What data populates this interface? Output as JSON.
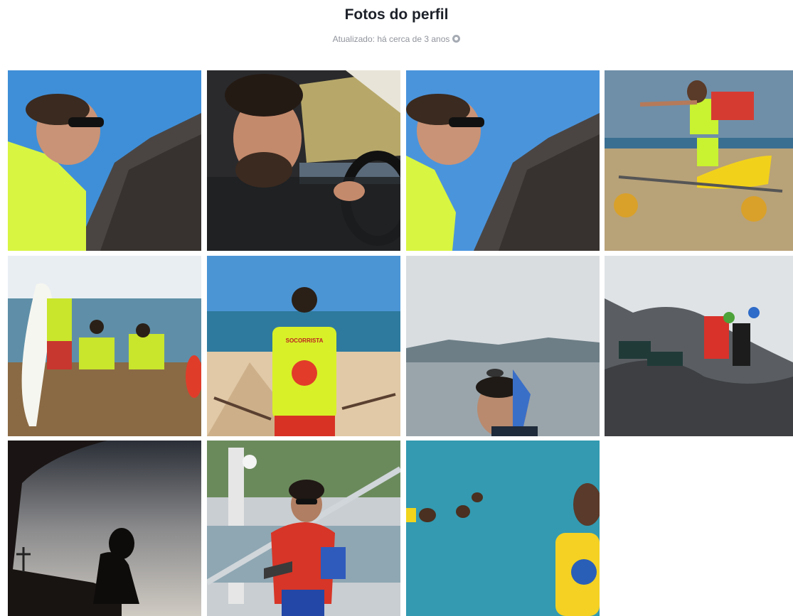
{
  "page": {
    "title": "Fotos do perfil",
    "updated_text": "Atualizado: há cerca de 3 anos",
    "privacy_icon": "globe-icon"
  },
  "photos": [
    {
      "id": "photo-1",
      "desc_icon": "profile-photo"
    },
    {
      "id": "photo-2",
      "desc_icon": "profile-photo"
    },
    {
      "id": "photo-3",
      "desc_icon": "profile-photo"
    },
    {
      "id": "photo-4",
      "desc_icon": "profile-photo"
    },
    {
      "id": "photo-5",
      "desc_icon": "profile-photo"
    },
    {
      "id": "photo-6",
      "desc_icon": "profile-photo",
      "vest_text": "SOCORRISTA"
    },
    {
      "id": "photo-7",
      "desc_icon": "profile-photo"
    },
    {
      "id": "photo-8",
      "desc_icon": "profile-photo"
    },
    {
      "id": "photo-9",
      "desc_icon": "profile-photo"
    },
    {
      "id": "photo-10",
      "desc_icon": "profile-photo"
    },
    {
      "id": "photo-11",
      "desc_icon": "profile-photo"
    }
  ]
}
